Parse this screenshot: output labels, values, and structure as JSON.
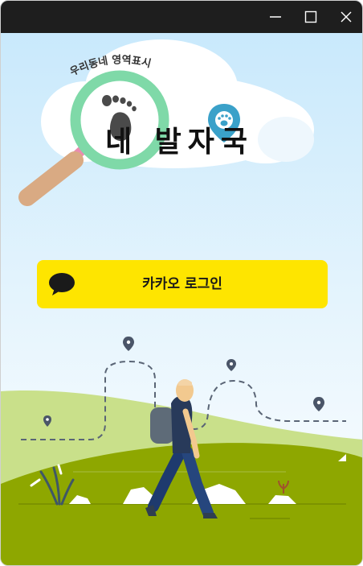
{
  "window": {
    "controls": [
      "minimize-icon",
      "maximize-icon",
      "close-icon"
    ]
  },
  "logo": {
    "tagline": "우리동네 영역표시",
    "title": "네 발자국"
  },
  "login": {
    "kakao_label": "카카오 로그인",
    "icon": "speech-bubble-icon"
  },
  "colors": {
    "titlebar": "#1e1e1e",
    "kakao_yellow": "#fee500",
    "sky": "#dff1fd",
    "grass": "#8fa800",
    "hill": "#c7df8a"
  }
}
